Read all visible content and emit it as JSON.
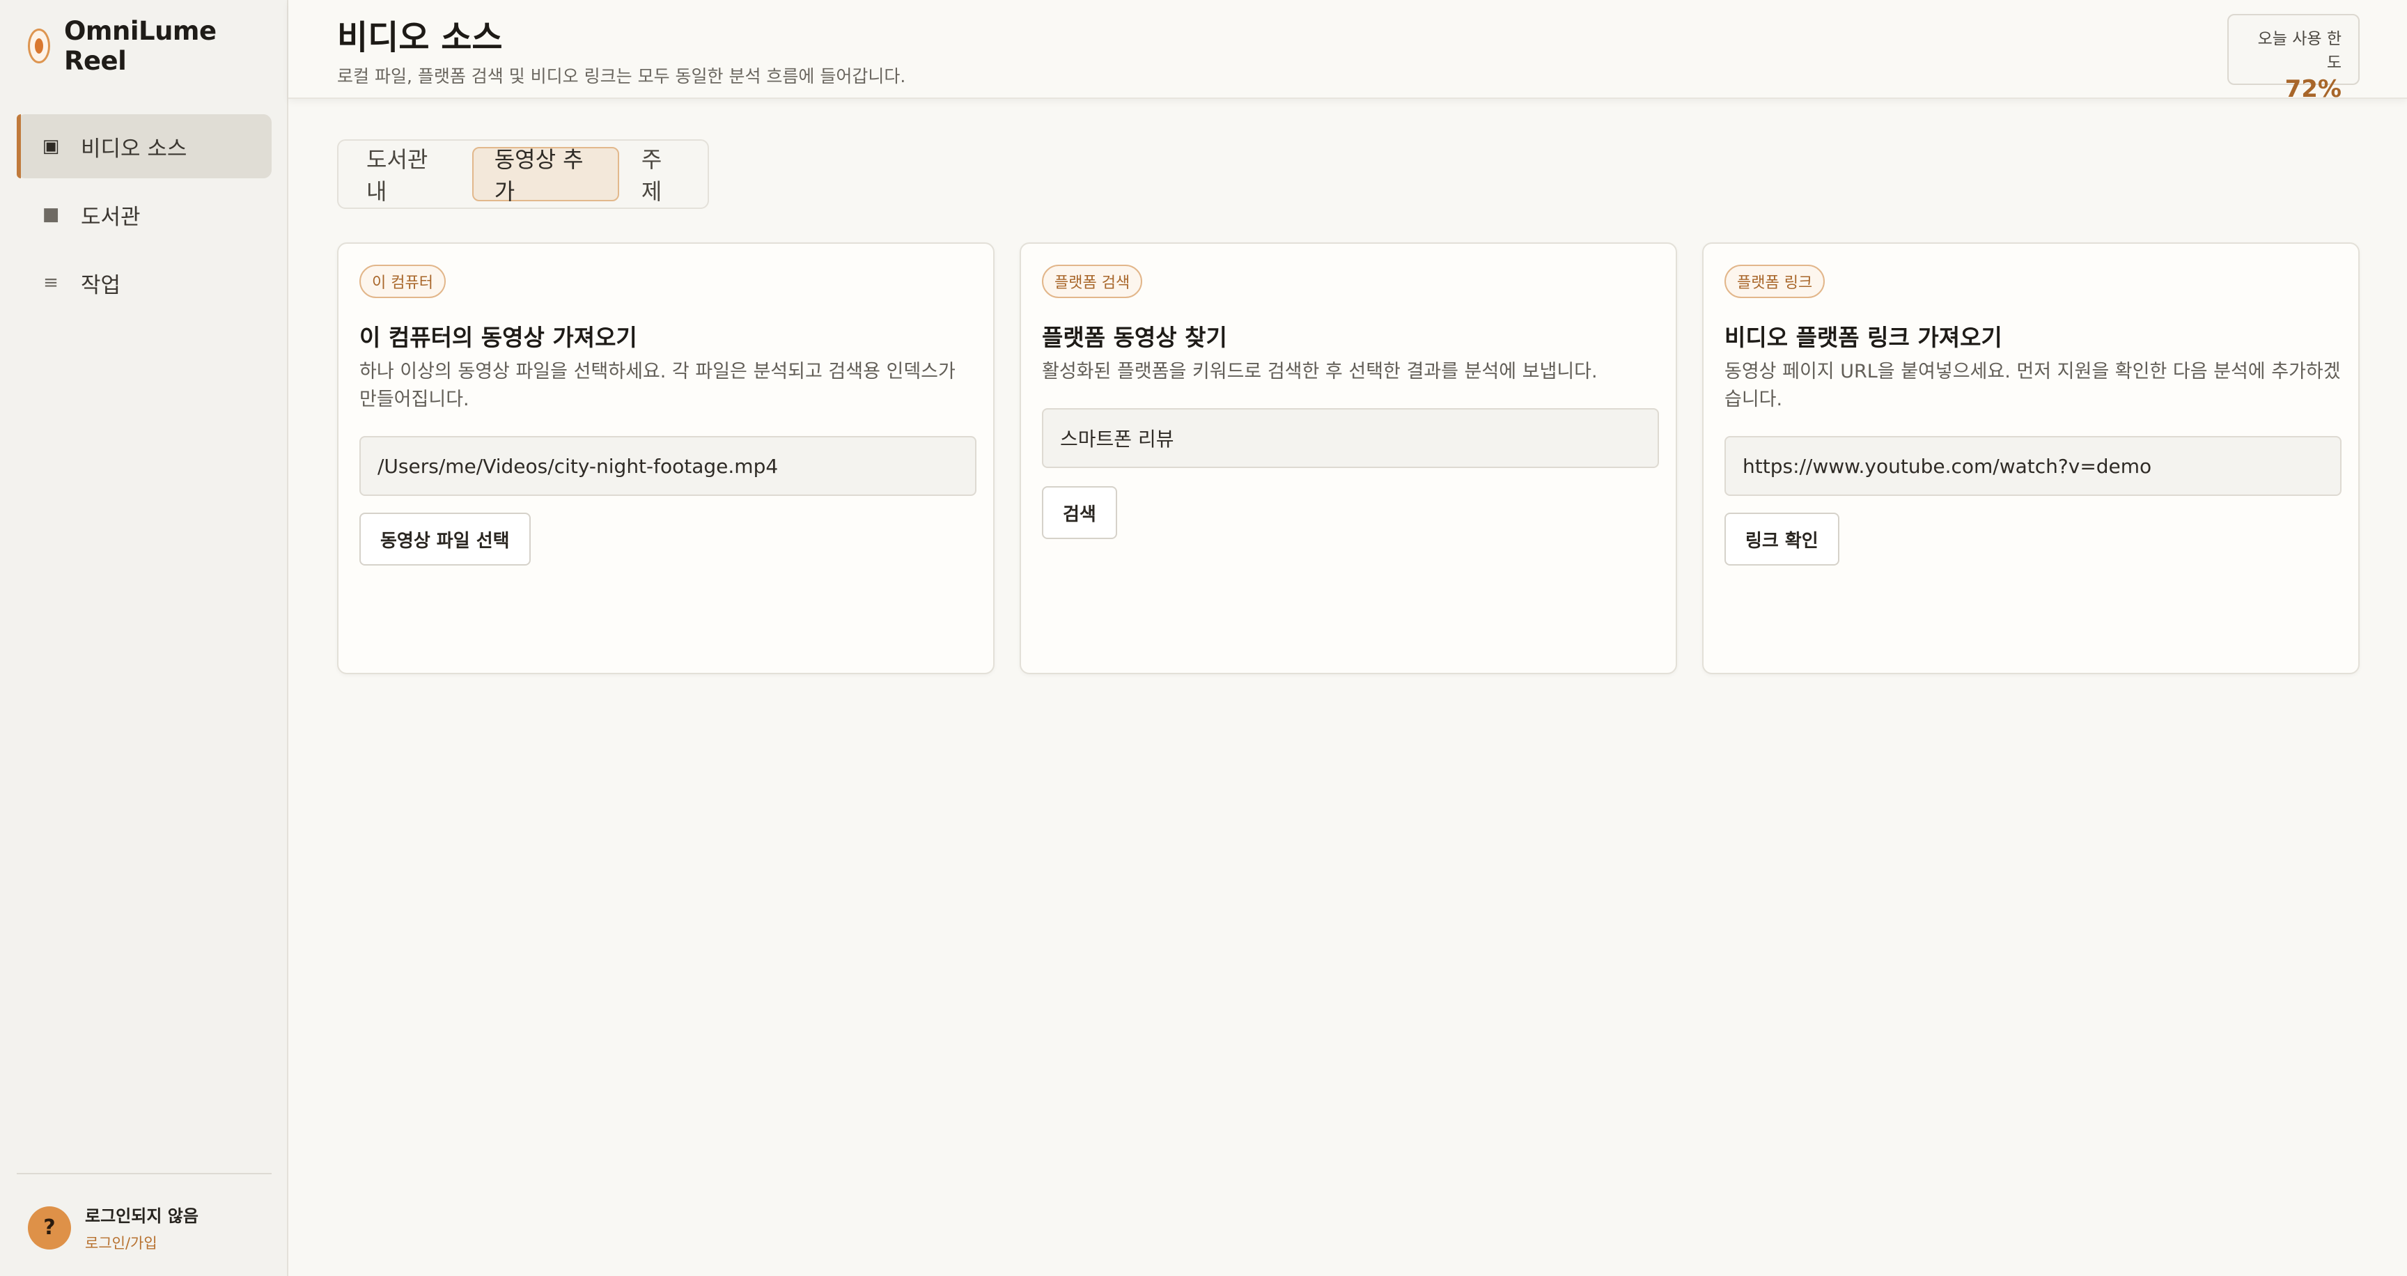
{
  "app": {
    "name": "OmniLume Reel"
  },
  "sidebar": {
    "items": [
      {
        "label": "비디오 소스",
        "icon": "video-source-icon",
        "active": true
      },
      {
        "label": "도서관",
        "icon": "library-icon",
        "active": false
      },
      {
        "label": "작업",
        "icon": "tasks-icon",
        "active": false
      }
    ],
    "user": {
      "avatar": "?",
      "status": "로그인되지 않음",
      "link": "로그인/가입"
    }
  },
  "header": {
    "title": "비디오 소스",
    "subtitle": "로컬 파일, 플랫폼 검색 및 비디오 링크는 모두 동일한 분석 흐름에 들어갑니다.",
    "quota": {
      "label": "오늘 사용 한도",
      "value": "72%"
    }
  },
  "tabs": [
    {
      "label": "도서관 내",
      "active": false
    },
    {
      "label": "동영상 추가",
      "active": true
    },
    {
      "label": "주제",
      "active": false
    }
  ],
  "cards": [
    {
      "badge": "이 컴퓨터",
      "title": "이 컴퓨터의 동영상 가져오기",
      "description": "하나 이상의 동영상 파일을 선택하세요. 각 파일은 분석되고 검색용 인덱스가 만들어집니다.",
      "field_value": "/Users/me/Videos/city-night-footage.mp4",
      "button": "동영상 파일 선택"
    },
    {
      "badge": "플랫폼 검색",
      "title": "플랫폼 동영상 찾기",
      "description": "활성화된 플랫폼을 키워드로 검색한 후 선택한 결과를 분석에 보냅니다.",
      "field_value": "스마트폰 리뷰",
      "button": "검색"
    },
    {
      "badge": "플랫폼 링크",
      "title": "비디오 플랫폼 링크 가져오기",
      "description": "동영상 페이지 URL을 붙여넣으세요. 먼저 지원을 확인한 다음 분석에 추가하겠습니다.",
      "field_value": "https://www.youtube.com/watch?v=demo",
      "button": "링크 확인"
    }
  ],
  "colors": {
    "accent": "#c07a3b",
    "quota": "#a8662a",
    "avatar": "#de9148"
  }
}
